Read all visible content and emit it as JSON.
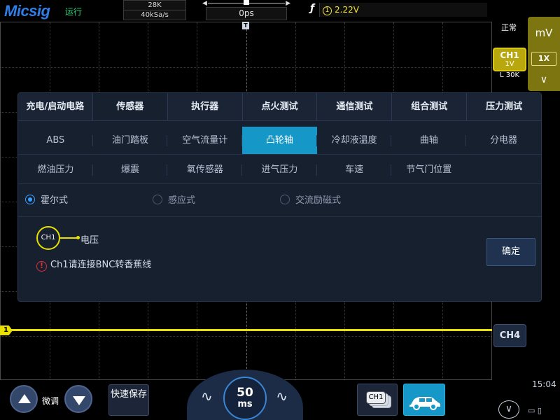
{
  "topbar": {
    "logo": "Micsig",
    "run_state": "运行",
    "memory_depth": "28K",
    "sample_rate": "40kSa/s",
    "time_position": "0ps",
    "trigger_source": "1",
    "trigger_level": "2.22V"
  },
  "grid": {
    "trigger_marker": "T",
    "channel_marker": "1"
  },
  "right_panel": {
    "status": "正常",
    "ch1_label": "CH1",
    "ch1_scale": "1V",
    "ch1_memory": "L 30K",
    "unit": "mV",
    "probe": "1X",
    "ch4_label": "CH4"
  },
  "dialog": {
    "tabs": [
      {
        "label": "充电/启动电路",
        "active": false
      },
      {
        "label": "传感器",
        "active": true
      },
      {
        "label": "执行器",
        "active": false
      },
      {
        "label": "点火测试",
        "active": false
      },
      {
        "label": "通信测试",
        "active": false
      },
      {
        "label": "组合测试",
        "active": false
      },
      {
        "label": "压力测试",
        "active": false
      }
    ],
    "sensors_row1": [
      "ABS",
      "油门踏板",
      "空气流量计",
      "凸轮轴",
      "冷却液温度",
      "曲轴",
      "分电器"
    ],
    "sensors_row2": [
      "燃油压力",
      "爆震",
      "氧传感器",
      "进气压力",
      "车速",
      "节气门位置"
    ],
    "active_sensor": "凸轮轴",
    "types": [
      {
        "label": "霍尔式",
        "selected": true
      },
      {
        "label": "感应式",
        "selected": false
      },
      {
        "label": "交流励磁式",
        "selected": false
      }
    ],
    "channel_badge": "CH1",
    "channel_signal": "电压",
    "warning": "Ch1请连接BNC转香蕉线",
    "confirm": "确定"
  },
  "bottom": {
    "fine_label": "微调",
    "quick_save": "快速保存",
    "timebase_value": "50",
    "timebase_unit": "ms",
    "channel_icon_label": "CH1",
    "time": "15:04"
  },
  "colors": {
    "ch1_yellow": "#e8e000",
    "accent_blue": "#1598c8",
    "dialog_bg": "#17202e",
    "warning_red": "#e0303a"
  }
}
